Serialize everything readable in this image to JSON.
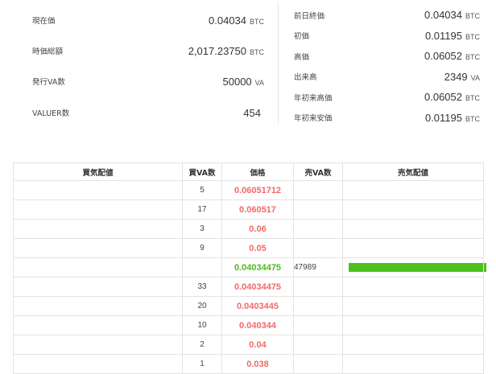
{
  "summary": {
    "left": [
      {
        "label": "現在価",
        "value": "0.04034",
        "unit": "BTC"
      },
      {
        "label": "時価総額",
        "value": "2,017.23750",
        "unit": "BTC"
      },
      {
        "label": "発行VA数",
        "value": "50000",
        "unit": "VA"
      },
      {
        "label": "VALUER数",
        "value": "454",
        "unit": ""
      }
    ],
    "right": [
      {
        "label": "前日終価",
        "value": "0.04034",
        "unit": "BTC"
      },
      {
        "label": "初価",
        "value": "0.01195",
        "unit": "BTC"
      },
      {
        "label": "高価",
        "value": "0.06052",
        "unit": "BTC"
      },
      {
        "label": "出来高",
        "value": "2349",
        "unit": "VA"
      },
      {
        "label": "年初来高価",
        "value": "0.06052",
        "unit": "BTC"
      },
      {
        "label": "年初来安価",
        "value": "0.01195",
        "unit": "BTC"
      }
    ]
  },
  "book": {
    "headers": {
      "buy_depth": "買気配値",
      "buy_va": "買VA数",
      "price": "価格",
      "sell_va": "売VA数",
      "sell_depth": "売気配値"
    },
    "rows": [
      {
        "buy_va": "5",
        "price": "0.06051712",
        "sell_va": "",
        "sell_fraction": 0
      },
      {
        "buy_va": "17",
        "price": "0.060517",
        "sell_va": "",
        "sell_fraction": 0
      },
      {
        "buy_va": "3",
        "price": "0.06",
        "sell_va": "",
        "sell_fraction": 0
      },
      {
        "buy_va": "9",
        "price": "0.05",
        "sell_va": "",
        "sell_fraction": 0
      },
      {
        "buy_va": "",
        "price": "0.04034475",
        "sell_va": "47989",
        "sell_fraction": 1.0
      },
      {
        "buy_va": "33",
        "price": "0.04034475",
        "sell_va": "",
        "sell_fraction": 0
      },
      {
        "buy_va": "20",
        "price": "0.0403445",
        "sell_va": "",
        "sell_fraction": 0
      },
      {
        "buy_va": "10",
        "price": "0.040344",
        "sell_va": "",
        "sell_fraction": 0
      },
      {
        "buy_va": "2",
        "price": "0.04",
        "sell_va": "",
        "sell_fraction": 0
      },
      {
        "buy_va": "1",
        "price": "0.038",
        "sell_va": "",
        "sell_fraction": 0
      }
    ],
    "last_trade_row": 4
  },
  "colors": {
    "ask_price": "#f06a6a",
    "last_price": "#4cba22",
    "depth_bar": "#4cc01f"
  }
}
